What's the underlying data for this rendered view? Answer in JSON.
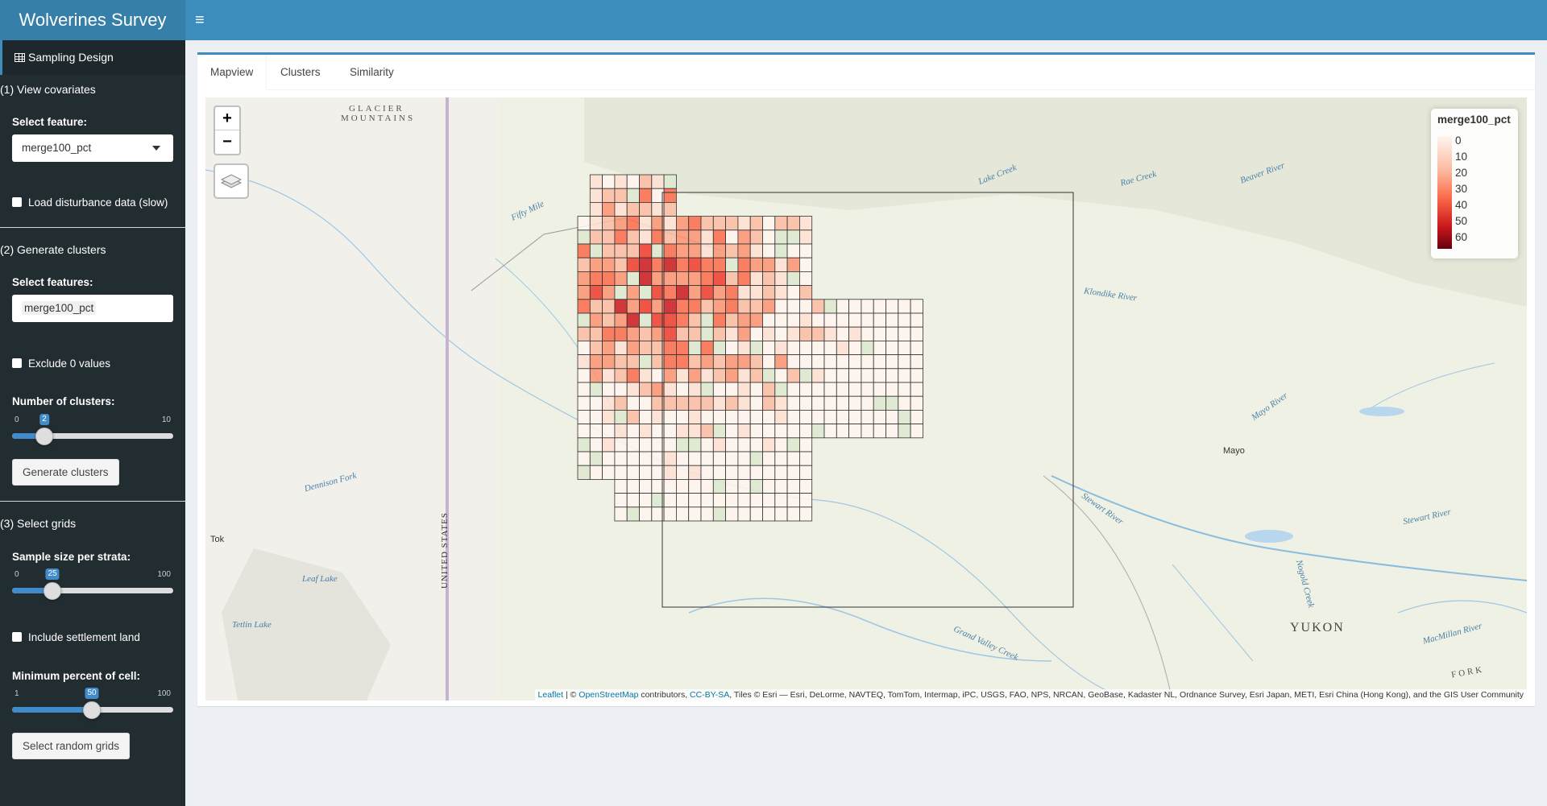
{
  "header": {
    "title": "Wolverines Survey"
  },
  "sidebar": {
    "menu_label": "Sampling Design",
    "sec1": "(1) View covariates",
    "select_feature_label": "Select feature:",
    "select_feature_value": "merge100_pct",
    "load_disturbance_label": "Load disturbance data (slow)",
    "sec2": "(2) Generate clusters",
    "select_features_label": "Select features:",
    "select_features_value": "merge100_pct",
    "exclude_zero_label": "Exclude 0 values",
    "num_clusters_label": "Number of clusters:",
    "num_clusters": {
      "min": "0",
      "max": "10",
      "value": "2",
      "fraction": 0.2
    },
    "generate_button": "Generate clusters",
    "sec3": "(3) Select grids",
    "sample_size_label": "Sample size per strata:",
    "sample_size": {
      "min": "0",
      "max": "100",
      "value": "25",
      "fraction": 0.25
    },
    "include_settlement_label": "Include settlement land",
    "min_percent_label": "Minimum percent of cell:",
    "min_percent": {
      "min": "1",
      "max": "100",
      "value": "50",
      "fraction": 0.495
    },
    "select_random_button": "Select random grids"
  },
  "tabs": [
    "Mapview",
    "Clusters",
    "Similarity"
  ],
  "map": {
    "legend_title": "merge100_pct",
    "legend_ticks": [
      "0",
      "10",
      "20",
      "30",
      "40",
      "50",
      "60"
    ],
    "places": [
      "GLACIER",
      "MOUNTAINS",
      "Mayo",
      "YUKON",
      "Tok",
      "UNITED STATES",
      "Lake Creek",
      "Klondike River",
      "Stewart River",
      "Mayo River",
      "Dennison Fork",
      "Leaf Lake",
      "Tetlin Lake",
      "Grand Valley Creek",
      "Rae Creek",
      "Beaver River",
      "Fifty Mile",
      "Nogold Creek",
      "MacMillan River",
      "Stewart River",
      "FORK"
    ],
    "attribution_leaflet": "Leaflet",
    "attribution_sep": " | © ",
    "attribution_osm": "OpenStreetMap",
    "attribution_mid": " contributors, ",
    "attribution_cc": "CC-BY-SA",
    "attribution_rest": ", Tiles © Esri — Esri, DeLorme, NAVTEQ, TomTom, Intermap, iPC, USGS, FAO, NPS, NRCAN, GeoBase, Kadaster NL, Ordnance Survey, Esri Japan, METI, Esri China (Hong Kong), and the GIS User Community",
    "colors": {
      "grid_line": "#333333",
      "low": "#fff5f0",
      "high": "#67000d"
    }
  }
}
